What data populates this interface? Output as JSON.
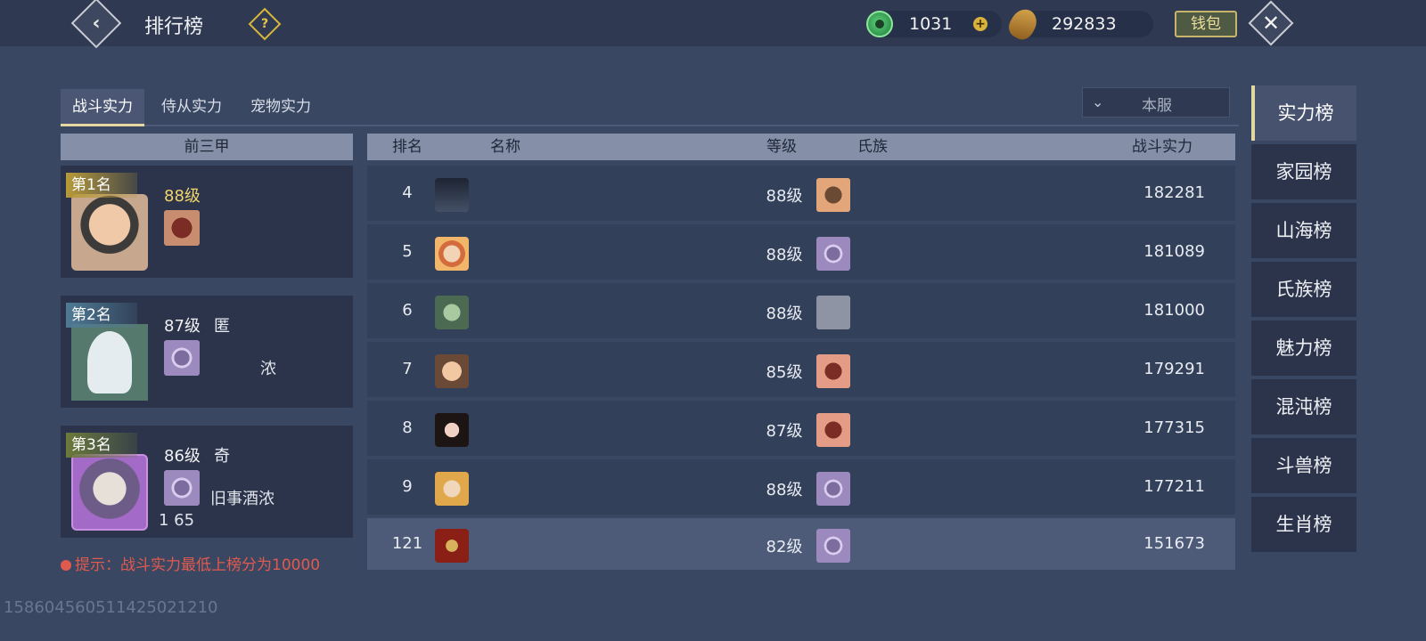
{
  "header": {
    "title": "排行榜",
    "jade_value": "1031",
    "gold_value": "292833",
    "wallet_label": "钱包",
    "back_icon": "back-icon",
    "close_icon": "close-icon"
  },
  "tabs": [
    {
      "label": "战斗实力",
      "active": true
    },
    {
      "label": "侍从实力",
      "active": false
    },
    {
      "label": "宠物实力",
      "active": false
    }
  ],
  "server_select": {
    "value": "本服"
  },
  "top3": {
    "header": "前三甲",
    "cards": [
      {
        "rank_label": "第1名",
        "level": "88级",
        "name": "",
        "clan": "",
        "power": ""
      },
      {
        "rank_label": "第2名",
        "level": "87级",
        "name": "匿",
        "clan": "浓",
        "power": ""
      },
      {
        "rank_label": "第3名",
        "level": "86级",
        "name": "奇",
        "clan": "旧事酒浓",
        "power": "1  65"
      }
    ]
  },
  "table": {
    "columns": {
      "rank": "排名",
      "name": "名称",
      "level": "等级",
      "clan": "氏族",
      "power": "战斗实力"
    },
    "rows": [
      {
        "rank": "4",
        "level": "88级",
        "power": "182281"
      },
      {
        "rank": "5",
        "level": "88级",
        "power": "181089"
      },
      {
        "rank": "6",
        "level": "88级",
        "power": "181000"
      },
      {
        "rank": "7",
        "level": "85级",
        "power": "179291"
      },
      {
        "rank": "8",
        "level": "87级",
        "power": "177315"
      },
      {
        "rank": "9",
        "level": "88级",
        "power": "177211"
      }
    ],
    "my_row": {
      "rank": "121",
      "level": "82级",
      "power": "151673"
    }
  },
  "hint": "提示：战斗实力最低上榜分为10000",
  "categories": [
    "实力榜",
    "家园榜",
    "山海榜",
    "氏族榜",
    "魅力榜",
    "混沌榜",
    "斗兽榜",
    "生肖榜"
  ],
  "footer_id": "1586045605114250212​10",
  "colors": {
    "accent_gold": "#e4d7a2",
    "hint_red": "#e05a4e"
  }
}
